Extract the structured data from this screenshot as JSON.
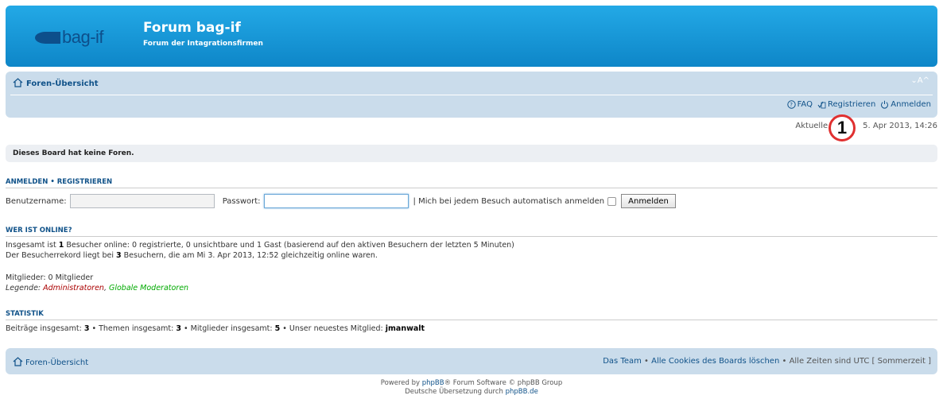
{
  "header": {
    "logo_text": "bag-if",
    "title": "Forum bag-if",
    "description": "Forum der Intagrationsfirmen"
  },
  "navbar": {
    "breadcrumb": "Foren-Übersicht",
    "font_resize": "⌄A^",
    "faq": "FAQ",
    "register": "Registrieren",
    "login": "Anmelden"
  },
  "time": {
    "prefix": "Aktuelle Z",
    "suffix": "5. Apr 2013, 14:26"
  },
  "marker": {
    "label": "1"
  },
  "no_forums": "Dieses Board hat keine Foren.",
  "login_section": {
    "title_login": "ANMELDEN",
    "separator": "•",
    "title_register": "REGISTRIEREN",
    "username_label": "Benutzername:",
    "username_value": "",
    "password_label": "Passwort:",
    "password_value": "",
    "autologin_label": "| Mich bei jedem Besuch automatisch anmelden",
    "button": "Anmelden"
  },
  "online": {
    "title": "WER IST ONLINE?",
    "line1_pre": "Insgesamt ist ",
    "line1_count": "1",
    "line1_post": " Besucher online: 0 registrierte, 0 unsichtbare und 1 Gast (basierend auf den aktiven Besuchern der letzten 5 Minuten)",
    "line2_pre": "Der Besucherrekord liegt bei ",
    "line2_count": "3",
    "line2_post": " Besuchern, die am Mi 3. Apr 2013, 12:52 gleichzeitig online waren.",
    "members": "Mitglieder: 0 Mitglieder",
    "legend_label": "Legende: ",
    "legend_admin": "Administratoren",
    "legend_sep": ", ",
    "legend_gmod": "Globale Moderatoren"
  },
  "stats": {
    "title": "STATISTIK",
    "posts_label": "Beiträge insgesamt: ",
    "posts": "3",
    "topics_label": " • Themen insgesamt: ",
    "topics": "3",
    "members_label": " • Mitglieder insgesamt: ",
    "members": "5",
    "newest_label": " • Unser neuestes Mitglied: ",
    "newest": "jmanwalt"
  },
  "footer": {
    "breadcrumb": "Foren-Übersicht",
    "team": "Das Team",
    "sep1": " • ",
    "cookies": "Alle Cookies des Boards löschen",
    "sep2": " • ",
    "timezone": "Alle Zeiten sind UTC [ Sommerzeit ]"
  },
  "copyright": {
    "powered_pre": "Powered by ",
    "phpbb": "phpBB",
    "powered_post": "® Forum Software © phpBB Group",
    "translation_pre": "Deutsche Übersetzung durch ",
    "translation_link": "phpBB.de"
  },
  "colors": {
    "header_blue": "#0e86c8",
    "nav_bg": "#cadceb",
    "link": "#105289",
    "admin": "#aa0000",
    "gmod": "#00aa00",
    "marker_ring": "#e03030"
  }
}
